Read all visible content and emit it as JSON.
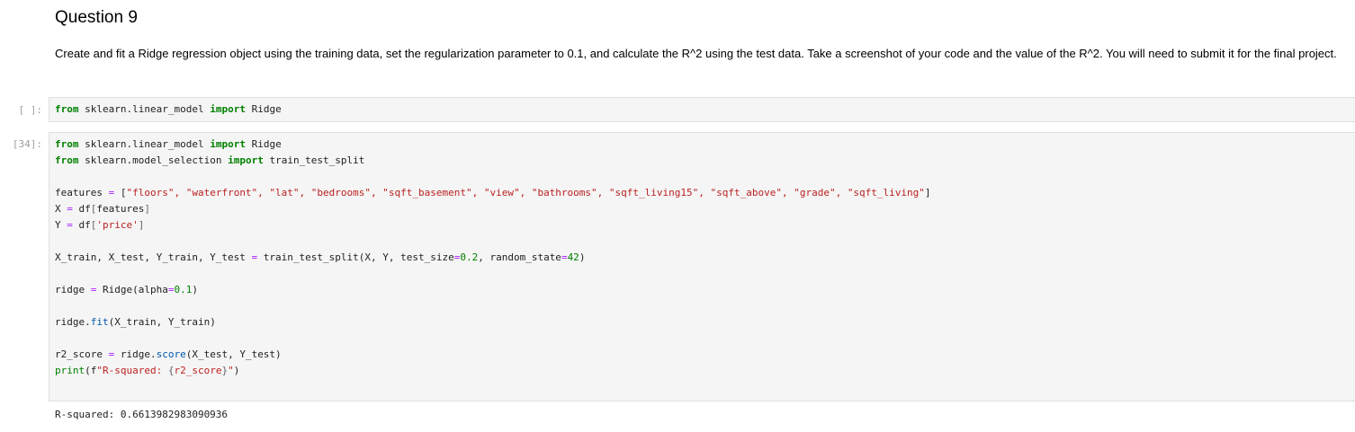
{
  "markdown": {
    "title": "Question 9",
    "body": "Create and fit a Ridge regression object using the training data, set the regularization parameter to 0.1, and calculate the R^2 using the test data. Take a screenshot of your code and the value of the R^2. You will need to submit it for the final project."
  },
  "cell1": {
    "prompt": "[ ]:",
    "code": {
      "kw_from": "from",
      "module": " sklearn.linear_model ",
      "kw_import": "import",
      "name": " Ridge"
    }
  },
  "cell2": {
    "prompt": "[34]:",
    "lines": {
      "l1_from": "from",
      "l1_mod": " sklearn.linear_model ",
      "l1_import": "import",
      "l1_name": " Ridge",
      "l2_from": "from",
      "l2_mod": " sklearn.model_selection ",
      "l2_import": "import",
      "l2_name": " train_test_split",
      "l4_var": "features ",
      "l4_eq": "=",
      "l4_open": " [",
      "l4_items": "\"floors\", \"waterfront\", \"lat\", \"bedrooms\", \"sqft_basement\", \"view\", \"bathrooms\", \"sqft_living15\", \"sqft_above\", \"grade\", \"sqft_living\"",
      "l4_close": "]",
      "l5_var": "X ",
      "l5_eq": "=",
      "l5_rest": " df",
      "l5_open": "[",
      "l5_arg": "features",
      "l5_close": "]",
      "l6_var": "Y ",
      "l6_eq": "=",
      "l6_rest": " df",
      "l6_open": "[",
      "l6_arg": "'price'",
      "l6_close": "]",
      "l8_var": "X_train, X_test, Y_train, Y_test ",
      "l8_eq": "=",
      "l8_call": " train_test_split(X, Y, test_size",
      "l8_eq2": "=",
      "l8_num1": "0.2",
      "l8_mid": ", random_state",
      "l8_eq3": "=",
      "l8_num2": "42",
      "l8_end": ")",
      "l10_var": "ridge ",
      "l10_eq": "=",
      "l10_call": " Ridge(alpha",
      "l10_eq2": "=",
      "l10_num": "0.1",
      "l10_end": ")",
      "l12_obj": "ridge.",
      "l12_fn": "fit",
      "l12_args": "(X_train, Y_train)",
      "l14_var": "r2_score ",
      "l14_eq": "=",
      "l14_obj": " ridge.",
      "l14_fn": "score",
      "l14_args": "(X_test, Y_test)",
      "l15_fn": "print",
      "l15_open": "(f",
      "l15_str1": "\"R-squared: ",
      "l15_brace1": "{",
      "l15_var": "r2_score",
      "l15_brace2": "}",
      "l15_str2": "\"",
      "l15_end": ")"
    }
  },
  "output": {
    "text": "R-squared: 0.6613982983090936"
  }
}
